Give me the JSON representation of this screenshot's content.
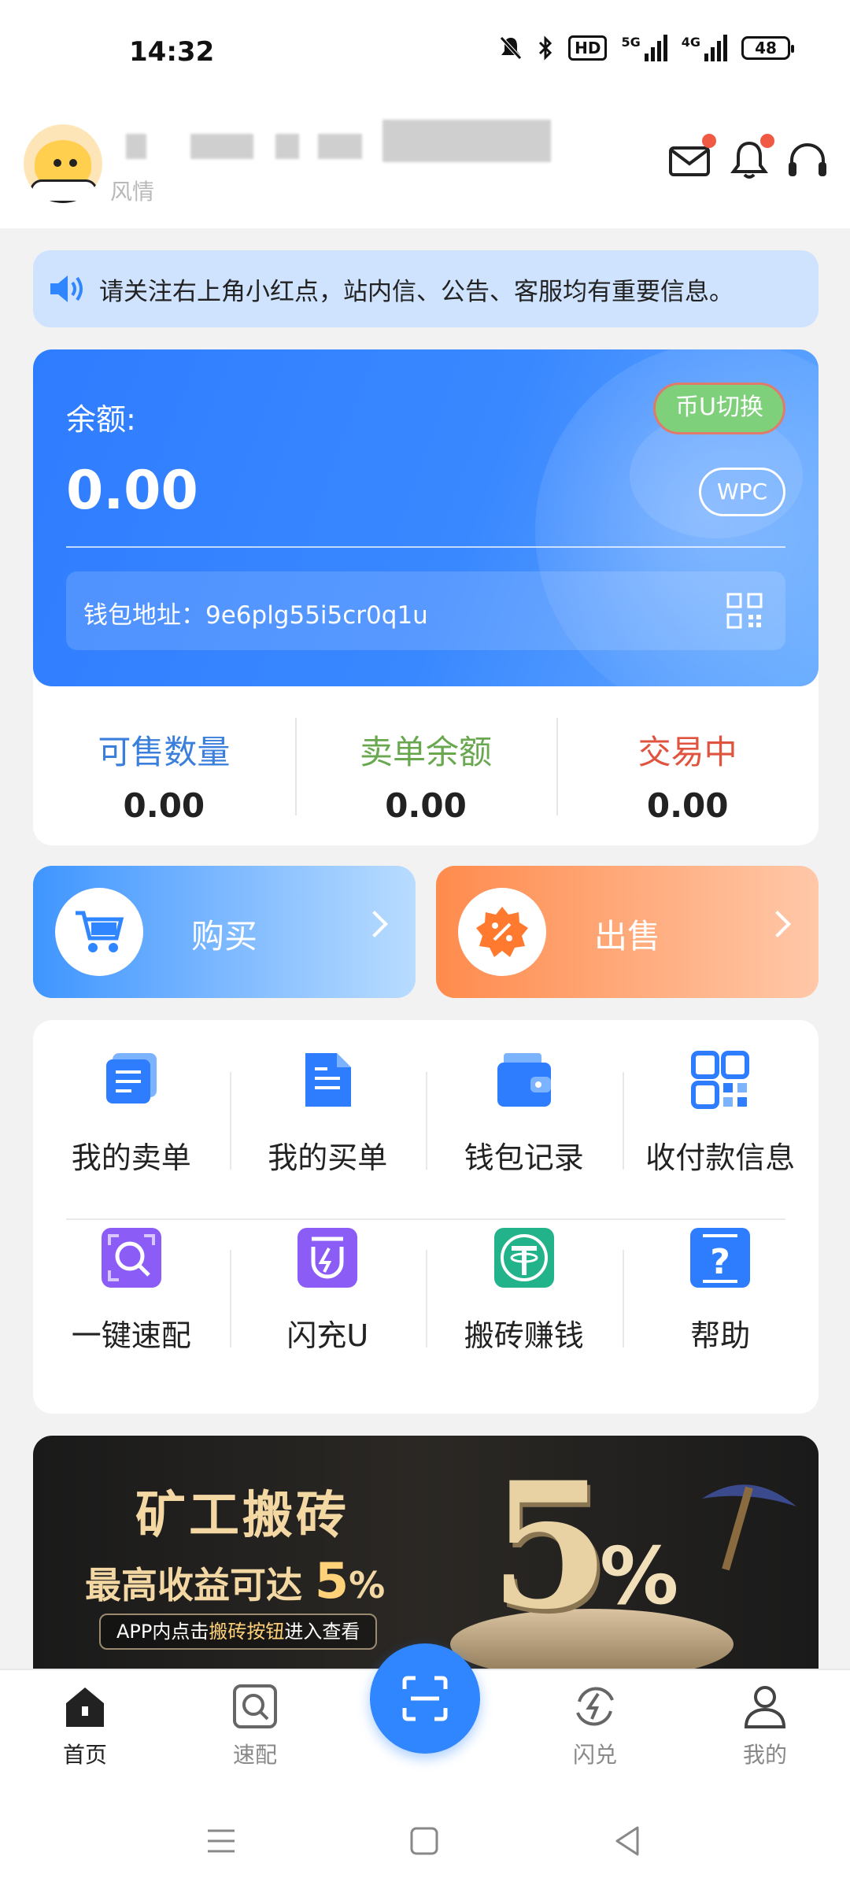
{
  "status_bar": {
    "time": "14:32",
    "hd_badge": "HD",
    "signal_1_label": "5G",
    "signal_2_label": "4G",
    "battery": "48",
    "icons": [
      "mute-icon",
      "bluetooth-icon",
      "hd-voice-icon",
      "signal-5g-icon",
      "signal-4g-icon",
      "battery-icon"
    ]
  },
  "header": {
    "username_redacted": "",
    "subtitle": "风情",
    "icons": [
      "mail-icon",
      "bell-icon",
      "headset-icon"
    ],
    "red_dot_color": "#f05a45"
  },
  "notice": {
    "text": "请关注右上角小红点，站内信、公告、客服均有重要信息。"
  },
  "balance": {
    "label": "余额:",
    "value": "0.00",
    "switch_label": "币U切换",
    "currency_label": "WPC",
    "wallet_address": "钱包地址：9e6plg55i5cr0q1u"
  },
  "stats": [
    {
      "label": "可售数量",
      "value": "0.00",
      "color": "#3b7fdc"
    },
    {
      "label": "卖单余额",
      "value": "0.00",
      "color": "#6aa84f"
    },
    {
      "label": "交易中",
      "value": "0.00",
      "color": "#e0533f"
    }
  ],
  "trade": {
    "buy_label": "购买",
    "sell_label": "出售"
  },
  "menu": {
    "row1": [
      {
        "label": "我的卖单",
        "icon": "sell-orders-icon"
      },
      {
        "label": "我的买单",
        "icon": "buy-orders-icon"
      },
      {
        "label": "钱包记录",
        "icon": "wallet-icon"
      },
      {
        "label": "收付款信息",
        "icon": "qr-grid-icon"
      }
    ],
    "row2": [
      {
        "label": "一键速配",
        "icon": "quick-match-icon"
      },
      {
        "label": "闪充U",
        "icon": "flash-charge-icon"
      },
      {
        "label": "搬砖赚钱",
        "icon": "tether-icon"
      },
      {
        "label": "帮助",
        "icon": "help-icon"
      }
    ]
  },
  "banner": {
    "title": "矿工搬砖",
    "subtitle_prefix": "最高收益可达",
    "subtitle_value": "5",
    "subtitle_suffix": "%",
    "note_prefix": "APP内点击",
    "note_highlight": "搬砖按钮",
    "note_suffix": "进入查看",
    "big_number": "5",
    "big_percent": "%"
  },
  "bottom_nav": {
    "items": [
      {
        "label": "首页",
        "icon": "home-icon",
        "active": true
      },
      {
        "label": "速配",
        "icon": "match-icon",
        "active": false
      },
      {
        "label": "",
        "icon": "scan-icon",
        "active": false
      },
      {
        "label": "闪兑",
        "icon": "flash-exchange-icon",
        "active": false
      },
      {
        "label": "我的",
        "icon": "profile-icon",
        "active": false
      }
    ]
  },
  "colors": {
    "accent": "#2f86ff",
    "sell": "#ff8b4d"
  }
}
